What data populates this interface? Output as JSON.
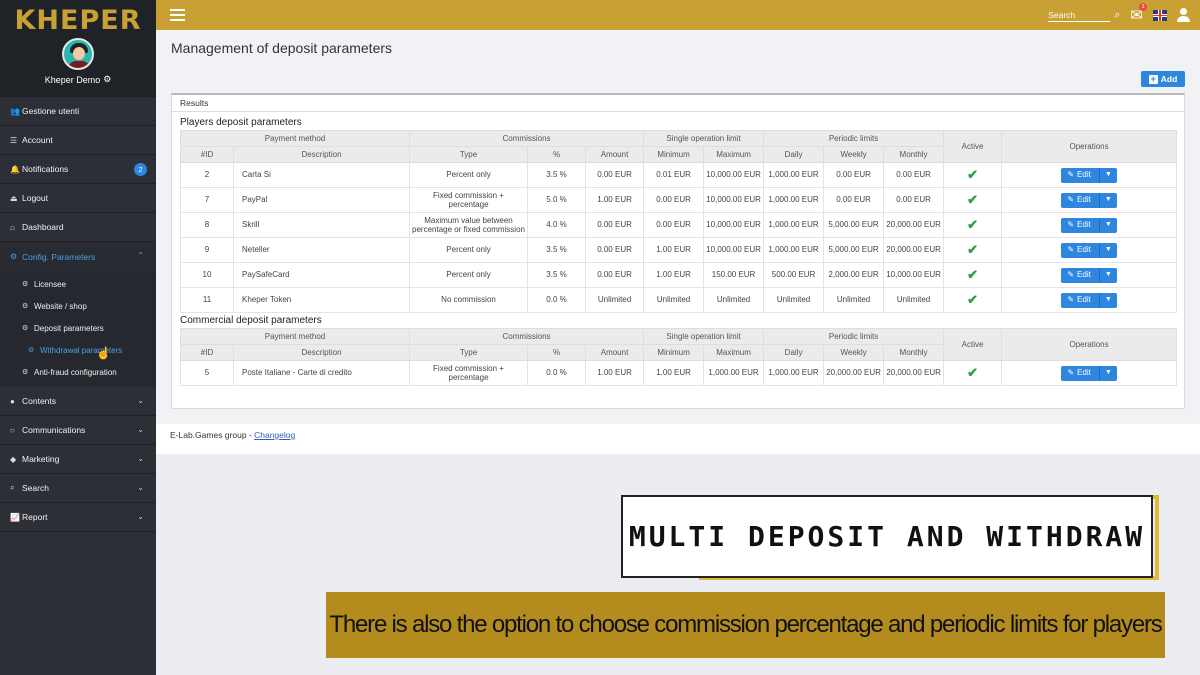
{
  "sidebar": {
    "logo": "KHEPER",
    "user_name": "Kheper Demo",
    "items": [
      {
        "label": "Gestione utenti",
        "icon": "users-icon"
      },
      {
        "label": "Account",
        "icon": "sliders-icon"
      },
      {
        "label": "Notifications",
        "icon": "bell-icon",
        "badge": "2"
      },
      {
        "label": "Logout",
        "icon": "logout-icon"
      },
      {
        "label": "Dashboard",
        "icon": "dashboard-icon"
      },
      {
        "label": "Config. Parameters",
        "icon": "cogs-icon"
      },
      {
        "label": "Contents",
        "icon": "globe-icon"
      },
      {
        "label": "Communications",
        "icon": "comment-icon"
      },
      {
        "label": "Marketing",
        "icon": "tag-icon"
      },
      {
        "label": "Search",
        "icon": "search-icon"
      },
      {
        "label": "Report",
        "icon": "chart-icon"
      }
    ],
    "subitems": [
      {
        "label": "Licensee"
      },
      {
        "label": "Website / shop"
      },
      {
        "label": "Deposit parameters"
      },
      {
        "label": "Withdrawal parameters"
      },
      {
        "label": "Anti-fraud configuration"
      }
    ]
  },
  "topbar": {
    "search_placeholder": "Search",
    "mail_badge": "3"
  },
  "page": {
    "title": "Management of deposit parameters",
    "add_label": "Add",
    "results_label": "Results",
    "players_title": "Players deposit parameters",
    "commercial_title": "Commercial deposit parameters",
    "footer_text": "E-Lab.Games group - ",
    "footer_link": "Changelog"
  },
  "table": {
    "group_headers": {
      "payment_method": "Payment method",
      "commissions": "Commissions",
      "single_limit": "Single operation limit",
      "periodic_limits": "Periodic limits",
      "active": "Active",
      "operations": "Operations"
    },
    "columns": [
      "#ID",
      "Description",
      "Type",
      "%",
      "Amount",
      "Minimum",
      "Maximum",
      "Daily",
      "Weekly",
      "Monthly"
    ],
    "edit_label": "Edit",
    "players_rows": [
      {
        "id": "2",
        "description": "Carta Si",
        "type": "Percent only",
        "pct": "3.5 %",
        "amount": "0.00 EUR",
        "min": "0.01 EUR",
        "max": "10,000.00 EUR",
        "daily": "1,000.00 EUR",
        "weekly": "0.00 EUR",
        "monthly": "0.00 EUR"
      },
      {
        "id": "7",
        "description": "PayPal",
        "type": "Fixed commission + percentage",
        "pct": "5.0 %",
        "amount": "1.00 EUR",
        "min": "0.00 EUR",
        "max": "10,000.00 EUR",
        "daily": "1,000.00 EUR",
        "weekly": "0.00 EUR",
        "monthly": "0.00 EUR"
      },
      {
        "id": "8",
        "description": "Skrill",
        "type": "Maximum value between percentage or fixed commission",
        "pct": "4.0 %",
        "amount": "0.00 EUR",
        "min": "0.00 EUR",
        "max": "10,000.00 EUR",
        "daily": "1,000.00 EUR",
        "weekly": "5,000.00 EUR",
        "monthly": "20,000.00 EUR"
      },
      {
        "id": "9",
        "description": "Neteller",
        "type": "Percent only",
        "pct": "3.5 %",
        "amount": "0.00 EUR",
        "min": "1.00 EUR",
        "max": "10,000.00 EUR",
        "daily": "1,000.00 EUR",
        "weekly": "5,000.00 EUR",
        "monthly": "20,000.00 EUR"
      },
      {
        "id": "10",
        "description": "PaySafeCard",
        "type": "Percent only",
        "pct": "3.5 %",
        "amount": "0.00 EUR",
        "min": "1.00 EUR",
        "max": "150.00 EUR",
        "daily": "500.00 EUR",
        "weekly": "2,000.00 EUR",
        "monthly": "10,000.00 EUR"
      },
      {
        "id": "11",
        "description": "Kheper Token",
        "type": "No commission",
        "pct": "0.0 %",
        "amount": "Unlimited",
        "min": "Unlimited",
        "max": "Unlimited",
        "daily": "Unlimited",
        "weekly": "Unlimited",
        "monthly": "Unlimited"
      }
    ],
    "commercial_rows": [
      {
        "id": "5",
        "description": "Poste Italiane - Carte di credito",
        "type": "Fixed commission + percentage",
        "pct": "0.0 %",
        "amount": "1.00 EUR",
        "min": "1.00 EUR",
        "max": "1,000.00 EUR",
        "daily": "1,000.00 EUR",
        "weekly": "20,000.00 EUR",
        "monthly": "20,000.00 EUR"
      }
    ]
  },
  "overlay": {
    "headline": "MULTI DEPOSIT AND WITHDRAW",
    "caption": "There is also the option to choose commission percentage and periodic limits for players"
  },
  "colors": {
    "accent_gold": "#c8a034",
    "primary_blue": "#2e86de",
    "sidebar_bg": "#2c2f36",
    "check_green": "#2e9e48"
  }
}
